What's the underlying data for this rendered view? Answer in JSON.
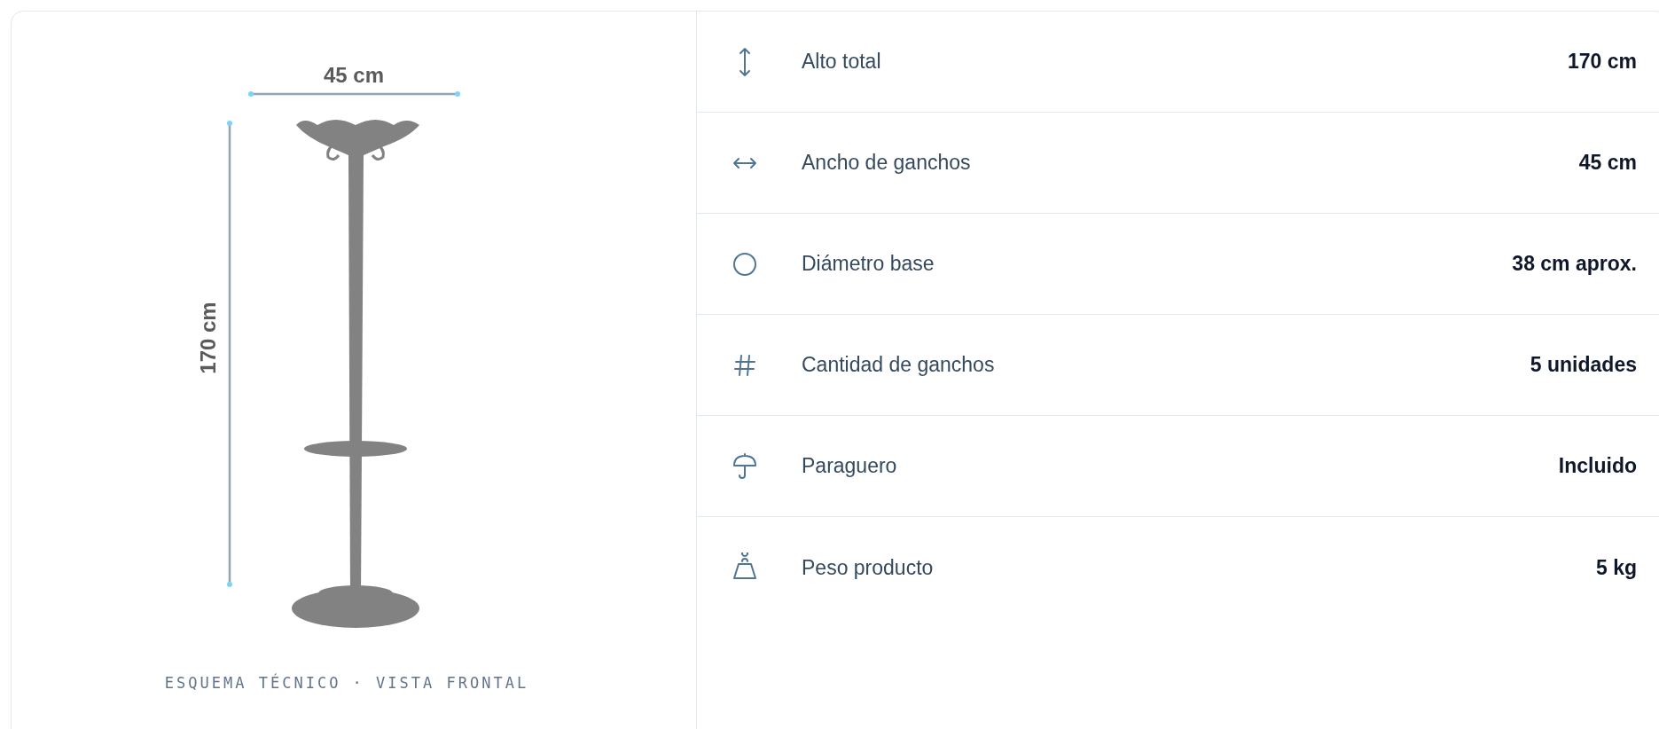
{
  "drawing": {
    "width_label": "45 cm",
    "height_label": "170 cm",
    "caption": "ESQUEMA TÉCNICO · VISTA FRONTAL"
  },
  "specs": [
    {
      "kind": "height",
      "label": "Alto total",
      "value": "170 cm"
    },
    {
      "kind": "width",
      "label": "Ancho de ganchos",
      "value": "45 cm"
    },
    {
      "kind": "diameter",
      "label": "Diámetro base",
      "value": "38 cm aprox."
    },
    {
      "kind": "count",
      "label": "Cantidad de ganchos",
      "value": "5 unidades"
    },
    {
      "kind": "umbrella",
      "label": "Paraguero",
      "value": "Incluido"
    },
    {
      "kind": "weight",
      "label": "Peso producto",
      "value": "5 kg"
    }
  ]
}
